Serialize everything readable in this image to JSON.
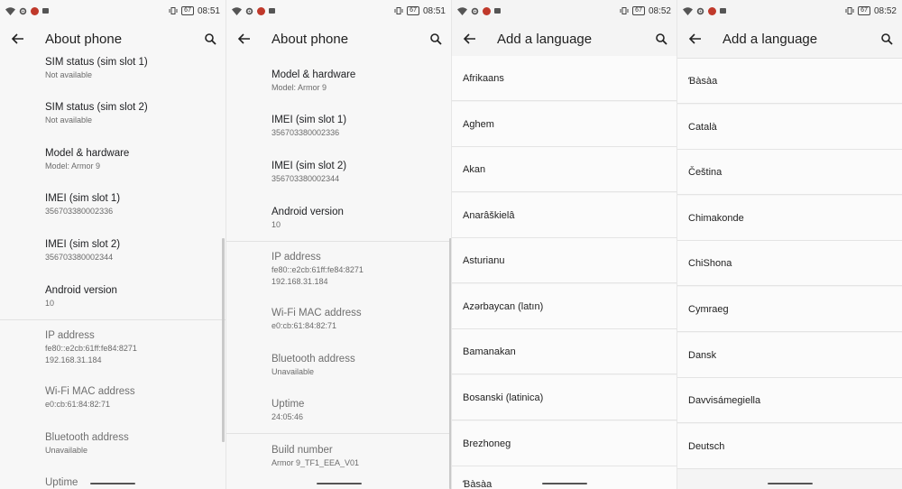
{
  "panels": [
    {
      "status": {
        "battery": "67",
        "time": "08:51"
      },
      "title": "About phone",
      "rows": [
        {
          "title": "SIM status (sim slot 1)",
          "sub": "Not available"
        },
        {
          "title": "SIM status (sim slot 2)",
          "sub": "Not available"
        },
        {
          "title": "Model & hardware",
          "sub": "Model: Armor 9"
        },
        {
          "title": "IMEI (sim slot 1)",
          "sub": "356703380002336"
        },
        {
          "title": "IMEI (sim slot 2)",
          "sub": "356703380002344"
        },
        {
          "title": "Android version",
          "sub": "10"
        },
        {
          "title": "IP address",
          "sub": "fe80::e2cb:61ff:fe84:8271",
          "sub2": "192.168.31.184"
        },
        {
          "title": "Wi-Fi MAC address",
          "sub": "e0:cb:61:84:82:71"
        },
        {
          "title": "Bluetooth address",
          "sub": "Unavailable"
        },
        {
          "title": "Uptime",
          "sub": ""
        }
      ]
    },
    {
      "status": {
        "battery": "67",
        "time": "08:51"
      },
      "title": "About phone",
      "rows": [
        {
          "title": "Model & hardware",
          "sub": "Model: Armor 9"
        },
        {
          "title": "IMEI (sim slot 1)",
          "sub": "356703380002336"
        },
        {
          "title": "IMEI (sim slot 2)",
          "sub": "356703380002344"
        },
        {
          "title": "Android version",
          "sub": "10"
        },
        {
          "title": "IP address",
          "sub": "fe80::e2cb:61ff:fe84:8271",
          "sub2": "192.168.31.184"
        },
        {
          "title": "Wi-Fi MAC address",
          "sub": "e0:cb:61:84:82:71"
        },
        {
          "title": "Bluetooth address",
          "sub": "Unavailable"
        },
        {
          "title": "Uptime",
          "sub": "24:05:46"
        },
        {
          "title": "Build number",
          "sub": "Armor 9_TF1_EEA_V01"
        }
      ]
    },
    {
      "status": {
        "battery": "67",
        "time": "08:52"
      },
      "title": "Add a language",
      "languages": [
        "Afrikaans",
        "Aghem",
        "Akan",
        "Anarâškielâ",
        "Asturianu",
        "Azərbaycan (latın)",
        "Bamanakan",
        "Bosanski (latinica)",
        "Brezhoneg",
        "Ɓàsàa"
      ]
    },
    {
      "status": {
        "battery": "67",
        "time": "08:52"
      },
      "title": "Add a language",
      "languages": [
        "Ɓàsàa",
        "Català",
        "Čeština",
        "Chimakonde",
        "ChiShona",
        "Cymraeg",
        "Dansk",
        "Davvisámegiella",
        "Deutsch"
      ]
    }
  ]
}
